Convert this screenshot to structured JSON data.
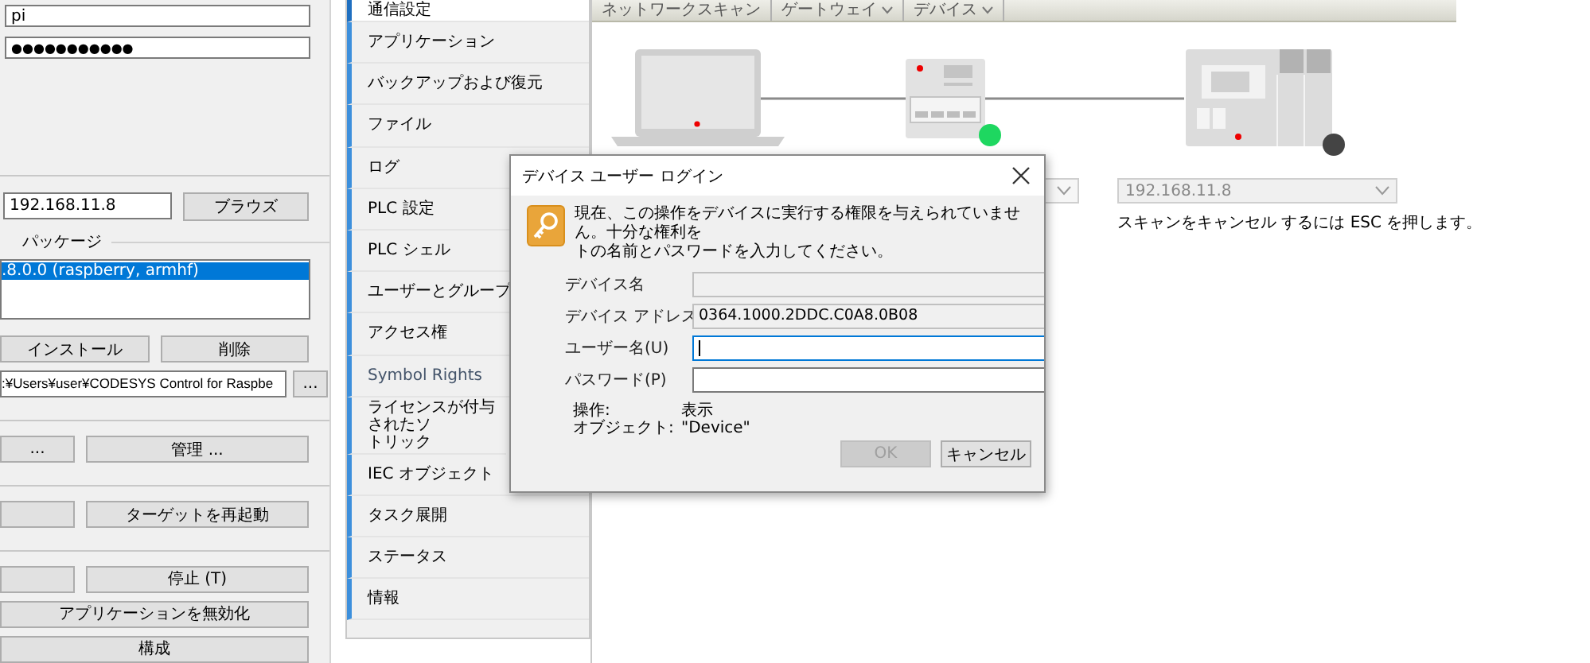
{
  "left_panel": {
    "username": "pi",
    "password": "●●●●●●●●●●●",
    "ip_address": "192.168.11.8",
    "browse_button": "ブラウズ",
    "package_group": {
      "title": "パッケージ",
      "items": [
        {
          "label": ".8.0.0 (raspberry, armhf)",
          "selected": true
        }
      ]
    },
    "package_buttons": [
      {
        "label": "インストール"
      },
      {
        "label": "削除"
      }
    ],
    "path": ":¥Users¥user¥CODESYS Control for Raspbe",
    "path_button": "...",
    "button_sections": [
      [
        [
          {
            "kind": "text",
            "label": "..."
          },
          {
            "kind": "text",
            "label": "管理 ..."
          }
        ]
      ],
      [
        [
          {
            "kind": "blank"
          },
          {
            "kind": "text",
            "label": "ターゲットを再起動"
          }
        ]
      ],
      [
        [
          {
            "kind": "blank"
          },
          {
            "kind": "text",
            "label": "停止 (T)"
          }
        ],
        [
          {
            "kind": "text",
            "label": "アプリケーションを無効化"
          }
        ],
        [
          {
            "kind": "text",
            "label": "構成"
          }
        ]
      ]
    ]
  },
  "nav_items": [
    {
      "lines": [
        "通信設定"
      ],
      "selected": true,
      "dimmed": false
    },
    {
      "lines": [
        "アプリケーション"
      ],
      "selected": false,
      "dimmed": false
    },
    {
      "lines": [
        "バックアップおよび復元"
      ],
      "selected": false,
      "dimmed": false
    },
    {
      "lines": [
        "ファイル"
      ],
      "selected": false,
      "dimmed": false
    },
    {
      "lines": [
        "ログ"
      ],
      "selected": false,
      "dimmed": false
    },
    {
      "lines": [
        "PLC 設定"
      ],
      "selected": false,
      "dimmed": false
    },
    {
      "lines": [
        "PLC シェル"
      ],
      "selected": false,
      "dimmed": false
    },
    {
      "lines": [
        "ユーザーとグループ"
      ],
      "selected": false,
      "dimmed": false
    },
    {
      "lines": [
        "アクセス権"
      ],
      "selected": false,
      "dimmed": false
    },
    {
      "lines": [
        "Symbol Rights"
      ],
      "selected": false,
      "dimmed": true
    },
    {
      "lines": [
        "ライセンスが付与されたソ",
        "トリック"
      ],
      "selected": false,
      "dimmed": false
    },
    {
      "lines": [
        "IEC オブジェクト"
      ],
      "selected": false,
      "dimmed": false
    },
    {
      "lines": [
        "タスク展開"
      ],
      "selected": false,
      "dimmed": false
    },
    {
      "lines": [
        "ステータス"
      ],
      "selected": false,
      "dimmed": false
    },
    {
      "lines": [
        "情報"
      ],
      "selected": false,
      "dimmed": false
    }
  ],
  "toolbar": [
    {
      "label": "ネットワークスキャン",
      "dropdown": false
    },
    {
      "label": "ゲートウェイ",
      "dropdown": true
    },
    {
      "label": "デバイス",
      "dropdown": true
    }
  ],
  "network": {
    "gateway_status": {
      "color": "#1ed760"
    },
    "device_status": {
      "color": "#444444"
    }
  },
  "device_dropdown": {
    "value": "192.168.11.8",
    "disabled": true
  },
  "scan_hint": "スキャンをキャンセル するには ESC を押します。",
  "dialog": {
    "title": "デバイス ユーザー ログイン",
    "message": [
      "現在、この操作をデバイスに実行する権限を与えられていません。十分な権利を",
      "トの名前とパスワードを入力してください。"
    ],
    "fields": [
      {
        "label": "デバイス名",
        "readonly": true,
        "focused": false
      },
      {
        "label": "デバイス アドレス",
        "value": "0364.1000.2DDC.C0A8.0B08",
        "readonly": true,
        "focused": false
      },
      {
        "label": "ユーザー名(U)",
        "readonly": false,
        "focused": true
      },
      {
        "label": "パスワード(P)",
        "readonly": false,
        "focused": false
      }
    ],
    "info": [
      {
        "label": "操作:",
        "value": "表示"
      },
      {
        "label": "オブジェクト:",
        "value": "\"Device\""
      }
    ],
    "buttons": [
      {
        "label": "OK",
        "disabled": true
      },
      {
        "label": "キャンセル",
        "disabled": false
      }
    ]
  }
}
